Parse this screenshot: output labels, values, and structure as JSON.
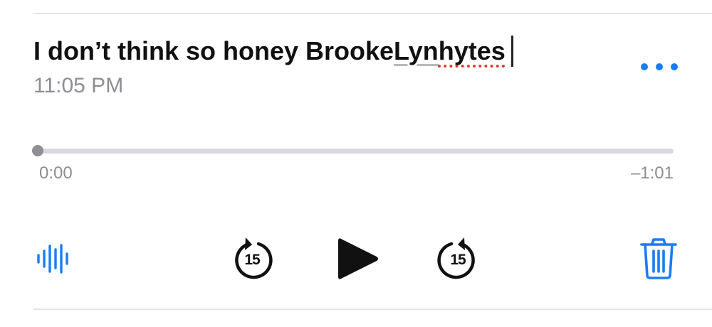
{
  "memo": {
    "title_words": [
      "I don’t think so honey Brooke ",
      "Lyn",
      " ",
      "hytes"
    ],
    "time": "11:05 PM"
  },
  "playback": {
    "elapsed": "0:00",
    "remaining": "–1:01",
    "progress_fraction": 0.0
  },
  "controls": {
    "skip_back_seconds": "15",
    "skip_forward_seconds": "15",
    "icons": {
      "more": "ellipsis-icon",
      "waveform": "waveform-icon",
      "skip_back": "skip-back-15-icon",
      "play": "play-icon",
      "skip_forward": "skip-forward-15-icon",
      "delete": "trash-icon"
    }
  },
  "colors": {
    "accent": "#1a7cf2",
    "secondary_text": "#8e8e93",
    "spellcheck_error": "#e0382f"
  }
}
